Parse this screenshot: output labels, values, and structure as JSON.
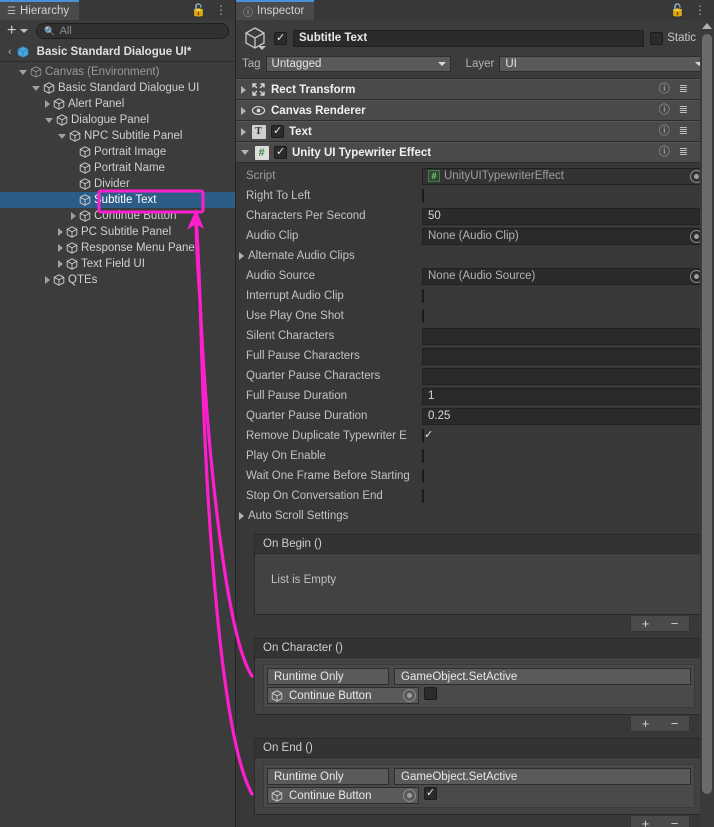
{
  "hierarchy": {
    "tab_label": "Hierarchy",
    "tab_icon": "hierarchy-icon",
    "lock_icon": "lock-icon",
    "menu_icon": "kebab-menu-icon",
    "toolbar": {
      "add_label": "+",
      "search_placeholder": "All",
      "search_value": "",
      "search_icon": "search-icon"
    },
    "breadcrumb": {
      "back_label": "‹",
      "label": "Basic Standard Dialogue UI*"
    },
    "items": [
      {
        "label": "Canvas (Environment)",
        "depth": 1,
        "toggle": "open",
        "dim": true,
        "selected": false
      },
      {
        "label": "Basic Standard Dialogue UI",
        "depth": 2,
        "toggle": "open",
        "dim": false,
        "selected": false
      },
      {
        "label": "Alert Panel",
        "depth": 3,
        "toggle": "closed",
        "dim": false,
        "selected": false
      },
      {
        "label": "Dialogue Panel",
        "depth": 3,
        "toggle": "open",
        "dim": false,
        "selected": false
      },
      {
        "label": "NPC Subtitle Panel",
        "depth": 4,
        "toggle": "open",
        "dim": false,
        "selected": false
      },
      {
        "label": "Portrait Image",
        "depth": 5,
        "toggle": "none",
        "dim": false,
        "selected": false
      },
      {
        "label": "Portrait Name",
        "depth": 5,
        "toggle": "none",
        "dim": false,
        "selected": false
      },
      {
        "label": "Divider",
        "depth": 5,
        "toggle": "none",
        "dim": false,
        "selected": false
      },
      {
        "label": "Subtitle Text",
        "depth": 5,
        "toggle": "none",
        "dim": false,
        "selected": true
      },
      {
        "label": "Continue Button",
        "depth": 5,
        "toggle": "closed",
        "dim": false,
        "selected": false
      },
      {
        "label": "PC Subtitle Panel",
        "depth": 4,
        "toggle": "closed",
        "dim": false,
        "selected": false
      },
      {
        "label": "Response Menu Panel",
        "depth": 4,
        "toggle": "closed",
        "dim": false,
        "selected": false
      },
      {
        "label": "Text Field UI",
        "depth": 4,
        "toggle": "closed",
        "dim": false,
        "selected": false
      },
      {
        "label": "QTEs",
        "depth": 3,
        "toggle": "closed",
        "dim": false,
        "selected": false
      }
    ]
  },
  "inspector": {
    "tab_label": "Inspector",
    "tab_icon": "info-icon",
    "lock_icon": "lock-icon",
    "menu_icon": "kebab-menu-icon",
    "gameobject": {
      "icon": "gameobject-cube-icon",
      "enabled": true,
      "name": "Subtitle Text",
      "static_label": "Static",
      "static_checked": false,
      "tag_label": "Tag",
      "tag_value": "Untagged",
      "layer_label": "Layer",
      "layer_value": "UI"
    },
    "components": [
      {
        "name": "Rect Transform",
        "icon": "rect-transform-icon",
        "expanded": false,
        "has_enable": false,
        "enabled": false
      },
      {
        "name": "Canvas Renderer",
        "icon": "canvas-renderer-eye-icon",
        "expanded": false,
        "has_enable": false,
        "enabled": false
      },
      {
        "name": "Text",
        "icon": "text-t-icon",
        "expanded": false,
        "has_enable": true,
        "enabled": true
      },
      {
        "name": "Unity UI Typewriter Effect",
        "icon": "script-hash-icon",
        "expanded": true,
        "has_enable": true,
        "enabled": true
      }
    ],
    "header_icons": {
      "help": "help-icon",
      "preset": "preset-icon",
      "menu": "kebab-menu-icon"
    },
    "properties": [
      {
        "kind": "object",
        "label": "Script",
        "value": "UnityUITypewriterEffect",
        "dim": true
      },
      {
        "kind": "checkbox",
        "label": "Right To Left",
        "checked": false
      },
      {
        "kind": "text",
        "label": "Characters Per Second",
        "value": "50"
      },
      {
        "kind": "object",
        "label": "Audio Clip",
        "value": "None (Audio Clip)",
        "dim": false
      },
      {
        "kind": "foldout",
        "label": "Alternate Audio Clips"
      },
      {
        "kind": "object",
        "label": "Audio Source",
        "value": "None (Audio Source)",
        "dim": false
      },
      {
        "kind": "checkbox",
        "label": "Interrupt Audio Clip",
        "checked": false
      },
      {
        "kind": "checkbox",
        "label": "Use Play One Shot",
        "checked": false
      },
      {
        "kind": "text",
        "label": "Silent Characters",
        "value": ""
      },
      {
        "kind": "text",
        "label": "Full Pause Characters",
        "value": ""
      },
      {
        "kind": "text",
        "label": "Quarter Pause Characters",
        "value": ""
      },
      {
        "kind": "text",
        "label": "Full Pause Duration",
        "value": "1"
      },
      {
        "kind": "text",
        "label": "Quarter Pause Duration",
        "value": "0.25"
      },
      {
        "kind": "checkbox",
        "label": "Remove Duplicate Typewriter E",
        "checked": true
      },
      {
        "kind": "checkbox",
        "label": "Play On Enable",
        "checked": false
      },
      {
        "kind": "checkbox",
        "label": "Wait One Frame Before Starting",
        "checked": false
      },
      {
        "kind": "checkbox",
        "label": "Stop On Conversation End",
        "checked": false
      },
      {
        "kind": "foldout",
        "label": "Auto Scroll Settings"
      }
    ],
    "events": [
      {
        "title": "On Begin ()",
        "empty_label": "List is Empty",
        "entries": [],
        "add_label": "+",
        "remove_label": "−"
      },
      {
        "title": "On Character ()",
        "empty_label": "",
        "entries": [
          {
            "mode": "Runtime Only",
            "function": "GameObject.SetActive",
            "target": "Continue Button",
            "arg_checked": false
          }
        ],
        "add_label": "+",
        "remove_label": "−"
      },
      {
        "title": "On End ()",
        "empty_label": "",
        "entries": [
          {
            "mode": "Runtime Only",
            "function": "GameObject.SetActive",
            "target": "Continue Button",
            "arg_checked": true
          }
        ],
        "add_label": "+",
        "remove_label": "−"
      }
    ]
  },
  "annotations": {
    "highlight_color": "#ff1ecd",
    "highlight_target": "Subtitle Text",
    "arrow_target": "Continue Button",
    "arrow_sources": [
      "On Character () target field",
      "On End () target field"
    ]
  },
  "colors": {
    "selection_blue": "#2c5d87",
    "panel_bg": "#383838",
    "hierarchy_bg": "#3c3c3c",
    "component_header": "#4a4a4a",
    "accent_magenta": "#ff1ecd",
    "tab_accent": "#4a90d9"
  }
}
